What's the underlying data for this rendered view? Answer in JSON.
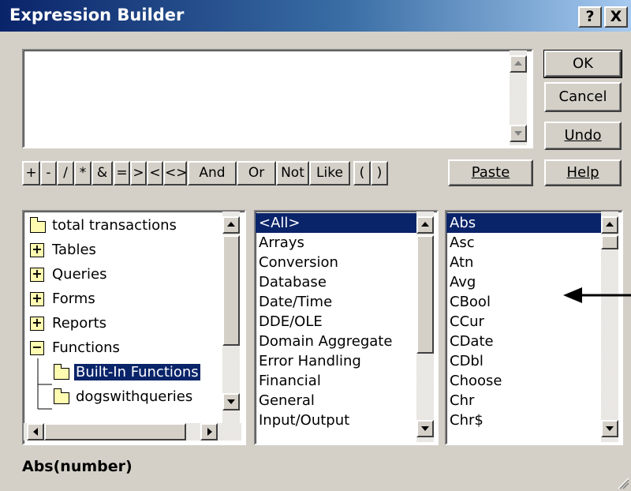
{
  "window": {
    "title": "Expression Builder",
    "help_label": "?",
    "close_label": "X"
  },
  "buttons": {
    "ok": "OK",
    "cancel": "Cancel",
    "undo": "Undo",
    "paste": "Paste",
    "help": "Help"
  },
  "operators": [
    "+",
    "-",
    "/",
    "*",
    "&",
    "=",
    ">",
    "<",
    "<>",
    "And",
    "Or",
    "Not",
    "Like",
    "(",
    ")"
  ],
  "tree": {
    "items": [
      {
        "label": "total transactions",
        "icon": "folder-icon"
      },
      {
        "label": "Tables",
        "icon": "expand-plus-icon"
      },
      {
        "label": "Queries",
        "icon": "expand-plus-icon"
      },
      {
        "label": "Forms",
        "icon": "expand-plus-icon"
      },
      {
        "label": "Reports",
        "icon": "expand-plus-icon"
      },
      {
        "label": "Functions",
        "icon": "collapse-minus-icon"
      },
      {
        "label": "Built-In Functions",
        "icon": "open-folder-icon",
        "selected": true
      },
      {
        "label": "dogswithqueries",
        "icon": "folder-icon"
      }
    ]
  },
  "categories": {
    "items": [
      "<All>",
      "Arrays",
      "Conversion",
      "Database",
      "Date/Time",
      "DDE/OLE",
      "Domain Aggregate",
      "Error Handling",
      "Financial",
      "General",
      "Input/Output"
    ],
    "selected": "<All>"
  },
  "functions": {
    "items": [
      "Abs",
      "Asc",
      "Atn",
      "Avg",
      "CBool",
      "CCur",
      "CDate",
      "CDbl",
      "Choose",
      "Chr",
      "Chr$"
    ],
    "selected": "Abs"
  },
  "status": {
    "syntax": "Abs(number)"
  },
  "colors": {
    "selection": "#0a246a",
    "face": "#d4d0c8",
    "title_start": "#0a246a"
  }
}
